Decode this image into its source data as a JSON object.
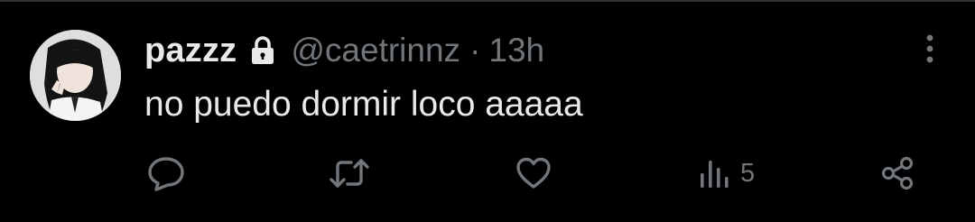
{
  "tweet": {
    "display_name": "pazzz",
    "handle": "@caetrinnz",
    "separator": "·",
    "time": "13h",
    "text": "no puedo dormir loco aaaaa"
  },
  "actions": {
    "views_count": "5"
  },
  "icons": {
    "lock": "lock-icon",
    "more": "more-vertical-icon",
    "reply": "reply-icon",
    "retweet": "retweet-icon",
    "like": "heart-icon",
    "views": "views-bar-chart-icon",
    "share": "share-icon"
  },
  "colors": {
    "background": "#000000",
    "primary_text": "#e7e9ea",
    "secondary_text": "#71767b",
    "divider": "#2f3336"
  }
}
